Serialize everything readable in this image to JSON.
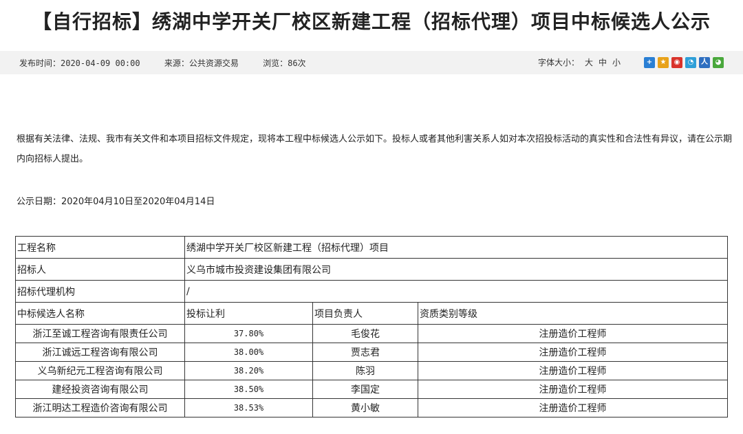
{
  "title": "【自行招标】绣湖中学开关厂校区新建工程（招标代理）项目中标候选人公示",
  "meta": {
    "publish_time": "发布时间：2020-04-09 00:00",
    "source": "来源：公共资源交易",
    "views": "浏览：86次",
    "font_size_label": "字体大小：",
    "font_sizes": [
      "大",
      "中",
      "小"
    ],
    "share_icons": [
      "share-plus-icon",
      "qzone-icon",
      "weibo-icon",
      "pengyou-icon",
      "renren-icon",
      "wechat-icon"
    ],
    "share_colors": [
      "#2a7fd4",
      "#e8a21a",
      "#d9332b",
      "#2f9fd8",
      "#2f6fc0",
      "#4aa83c"
    ]
  },
  "intro": "根据有关法律、法规、我市有关文件和本项目招标文件规定，现将本工程中标候选人公示如下。投标人或者其他利害关系人如对本次招投标活动的真实性和合法性有异议，请在公示期内向招标人提出。",
  "pub_date": "公示日期：2020年04月10日至2020年04月14日",
  "table": {
    "project_label": "工程名称",
    "project_value": "绣湖中学开关厂校区新建工程（招标代理）项目",
    "tenderer_label": "招标人",
    "tenderer_value": "义乌市城市投资建设集团有限公司",
    "agency_label": "招标代理机构",
    "agency_value": "/",
    "headers": [
      "中标候选人名称",
      "投标让利",
      "项目负责人",
      "资质类别等级"
    ],
    "candidates": [
      {
        "name": "浙江至诚工程咨询有限责任公司",
        "discount": "37.80%",
        "manager": "毛俊花",
        "qualification": "注册造价工程师"
      },
      {
        "name": "浙江诚远工程咨询有限公司",
        "discount": "38.00%",
        "manager": "贾志君",
        "qualification": "注册造价工程师"
      },
      {
        "name": "义乌新纪元工程咨询有限公司",
        "discount": "38.20%",
        "manager": "陈羽",
        "qualification": "注册造价工程师"
      },
      {
        "name": "建经投资咨询有限公司",
        "discount": "38.50%",
        "manager": "李国定",
        "qualification": "注册造价工程师"
      },
      {
        "name": "浙江明达工程造价咨询有限公司",
        "discount": "38.53%",
        "manager": "黄小敏",
        "qualification": "注册造价工程师"
      }
    ]
  }
}
